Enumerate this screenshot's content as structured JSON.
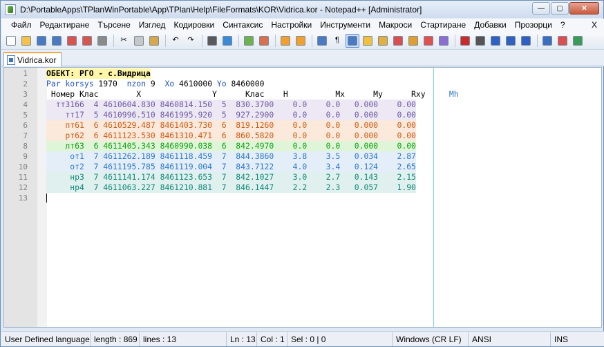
{
  "window": {
    "title": "D:\\PortableApps\\TPlanWinPortable\\App\\TPlan\\Help\\FileFormats\\KOR\\Vidrica.kor - Notepad++ [Administrator]",
    "minimize_glyph": "—",
    "maximize_glyph": "▢",
    "close_glyph": "✕"
  },
  "menu": {
    "items": [
      "Файл",
      "Редактиране",
      "Търсене",
      "Изглед",
      "Кодировки",
      "Синтаксис",
      "Настройки",
      "Инструменти",
      "Макроси",
      "Стартиране",
      "Добавки",
      "Прозорци",
      "?"
    ],
    "close_label": "X"
  },
  "toolbar": {
    "icons": [
      {
        "name": "new-file-icon",
        "glyph": "",
        "color": "#ffffff"
      },
      {
        "name": "open-file-icon",
        "glyph": "",
        "color": "#f2c14e"
      },
      {
        "name": "save-icon",
        "glyph": "",
        "color": "#4a7ac2"
      },
      {
        "name": "save-all-icon",
        "glyph": "",
        "color": "#4a7ac2"
      },
      {
        "name": "close-file-icon",
        "glyph": "",
        "color": "#d9534f"
      },
      {
        "name": "close-all-icon",
        "glyph": "",
        "color": "#d9534f"
      },
      {
        "name": "print-icon",
        "glyph": "",
        "color": "#8a8a8a"
      },
      {
        "name": "cut-icon",
        "glyph": "✂",
        "color": ""
      },
      {
        "name": "copy-icon",
        "glyph": "",
        "color": "#c7c7c7"
      },
      {
        "name": "paste-icon",
        "glyph": "",
        "color": "#d7a84a"
      },
      {
        "name": "undo-icon",
        "glyph": "↶",
        "color": ""
      },
      {
        "name": "redo-icon",
        "glyph": "↷",
        "color": ""
      },
      {
        "name": "find-icon",
        "glyph": "",
        "color": "#5a5a5a"
      },
      {
        "name": "replace-icon",
        "glyph": "",
        "color": "#3b8ad6"
      },
      {
        "name": "zoom-in-icon",
        "glyph": "",
        "color": "#6fb04f"
      },
      {
        "name": "zoom-out-icon",
        "glyph": "",
        "color": "#d96f4f"
      },
      {
        "name": "sync-vertical-icon",
        "glyph": "",
        "color": "#f0a030"
      },
      {
        "name": "sync-horizontal-icon",
        "glyph": "",
        "color": "#f0a030"
      },
      {
        "name": "word-wrap-icon",
        "glyph": "",
        "color": "#4a7ac2"
      },
      {
        "name": "show-all-chars-icon",
        "glyph": "¶",
        "color": ""
      },
      {
        "name": "indent-guide-icon",
        "glyph": "",
        "color": "#4a7ac2"
      },
      {
        "name": "user-language-icon",
        "glyph": "",
        "color": "#f0c040"
      },
      {
        "name": "doc-map-icon",
        "glyph": "",
        "color": "#e0b040"
      },
      {
        "name": "function-list-icon",
        "glyph": "",
        "color": "#d94f4f"
      },
      {
        "name": "folder-workspace-icon",
        "glyph": "",
        "color": "#e0a030"
      },
      {
        "name": "monitoring-icon",
        "glyph": "",
        "color": "#e05050"
      },
      {
        "name": "eye-icon",
        "glyph": "",
        "color": "#8a6fd0"
      },
      {
        "name": "record-macro-icon",
        "glyph": "",
        "color": "#cc2a2a"
      },
      {
        "name": "stop-macro-icon",
        "glyph": "",
        "color": "#555555"
      },
      {
        "name": "play-macro-icon",
        "glyph": "",
        "color": "#3060c0"
      },
      {
        "name": "run-macro-multiple-icon",
        "glyph": "",
        "color": "#3060c0"
      },
      {
        "name": "save-macro-icon",
        "glyph": "",
        "color": "#3060c0"
      },
      {
        "name": "plugin-down-icon",
        "glyph": "",
        "color": "#3c6ec0"
      },
      {
        "name": "plugin-list-icon",
        "glyph": "",
        "color": "#d94f4f"
      },
      {
        "name": "plugin-grid-icon",
        "glyph": "",
        "color": "#3c9b5a"
      }
    ]
  },
  "tab": {
    "label": "Vidrica.kor"
  },
  "editor": {
    "colors": {
      "header": "#000000",
      "keyword": "#2050c0",
      "group_tt": "#7058a0",
      "group_pt": "#d05a10",
      "group_lt": "#10a010",
      "group_ot": "#2a78c8",
      "group_nr": "#108878",
      "mh_header": "#2a78c8"
    },
    "lines": [
      {
        "n": "1",
        "bg": "#fff6a8",
        "tokens": [
          {
            "t": "ОБЕКТ: РГО - с.Видрица",
            "c": "#000000",
            "b": true
          }
        ]
      },
      {
        "n": "2",
        "bg": "",
        "tokens": [
          {
            "t": "Par korsys",
            "c": "#2050c0"
          },
          {
            "t": " 1970  ",
            "c": "#000000"
          },
          {
            "t": "nzon",
            "c": "#2050c0"
          },
          {
            "t": " 9  ",
            "c": "#000000"
          },
          {
            "t": "Xo",
            "c": "#2050c0"
          },
          {
            "t": " 4610000 ",
            "c": "#000000"
          },
          {
            "t": "Yo",
            "c": "#2050c0"
          },
          {
            "t": " 8460000",
            "c": "#000000"
          }
        ]
      },
      {
        "n": "3",
        "bg": "",
        "tokens": [
          {
            "t": " Номер Клас        X               Y      Клас    H          Mx      My      Rxy     ",
            "c": "#000000"
          },
          {
            "t": "Mh",
            "c": "#2a78c8"
          }
        ]
      },
      {
        "n": "4",
        "bg": "#ece9f5",
        "tokens": [
          {
            "t": "  тт3166  4 4610604.830 8460814.150  5  830.3700    0.0    0.0   0.000    0.00",
            "c": "#7058a0"
          }
        ]
      },
      {
        "n": "5",
        "bg": "#ece9f5",
        "tokens": [
          {
            "t": "    тт17  5 4610996.510 8461995.920  5  927.2900    0.0    0.0   0.000    0.00",
            "c": "#7058a0"
          }
        ]
      },
      {
        "n": "6",
        "bg": "#fbe9dc",
        "tokens": [
          {
            "t": "    пт61  6 4610529.487 8461403.730  6  819.1260    0.0    0.0   0.000    0.00",
            "c": "#d05a10"
          }
        ]
      },
      {
        "n": "7",
        "bg": "#fbe9dc",
        "tokens": [
          {
            "t": "    рт62  6 4611123.530 8461310.471  6  860.5820    0.0    0.0   0.000    0.00",
            "c": "#d05a10"
          }
        ]
      },
      {
        "n": "8",
        "bg": "#dff5d8",
        "tokens": [
          {
            "t": "    лт63  6 4611405.343 8460990.038  6  842.4970    0.0    0.0   0.000    0.00",
            "c": "#10a010"
          }
        ]
      },
      {
        "n": "9",
        "bg": "#e4eef9",
        "tokens": [
          {
            "t": "     от1  7 4611262.189 8461118.459  7  844.3860    3.8    3.5   0.034    2.87",
            "c": "#2a78c8"
          }
        ]
      },
      {
        "n": "10",
        "bg": "#e4eef9",
        "tokens": [
          {
            "t": "     от2  7 4611195.785 8461119.004  7  843.7122    4.0    3.4   0.124    2.65",
            "c": "#2a78c8"
          }
        ]
      },
      {
        "n": "11",
        "bg": "#dff0ee",
        "tokens": [
          {
            "t": "     нр3  7 4611141.174 8461123.653  7  842.1027    3.0    2.7   0.143    2.15",
            "c": "#108878"
          }
        ]
      },
      {
        "n": "12",
        "bg": "#dff0ee",
        "tokens": [
          {
            "t": "     нр4  7 4611063.227 8461210.881  7  846.1447    2.2    2.3   0.057    1.90",
            "c": "#108878"
          }
        ]
      },
      {
        "n": "13",
        "bg": "#e8e8ff",
        "tokens": [
          {
            "t": "",
            "c": "#000000"
          }
        ]
      }
    ]
  },
  "status": {
    "language": "User Defined language",
    "length": "length : 869",
    "lines": "lines : 13",
    "ln": "Ln : 13",
    "col": "Col : 1",
    "sel": "Sel : 0 | 0",
    "eol": "Windows (CR LF)",
    "encoding": "ANSI",
    "mode": "INS"
  }
}
